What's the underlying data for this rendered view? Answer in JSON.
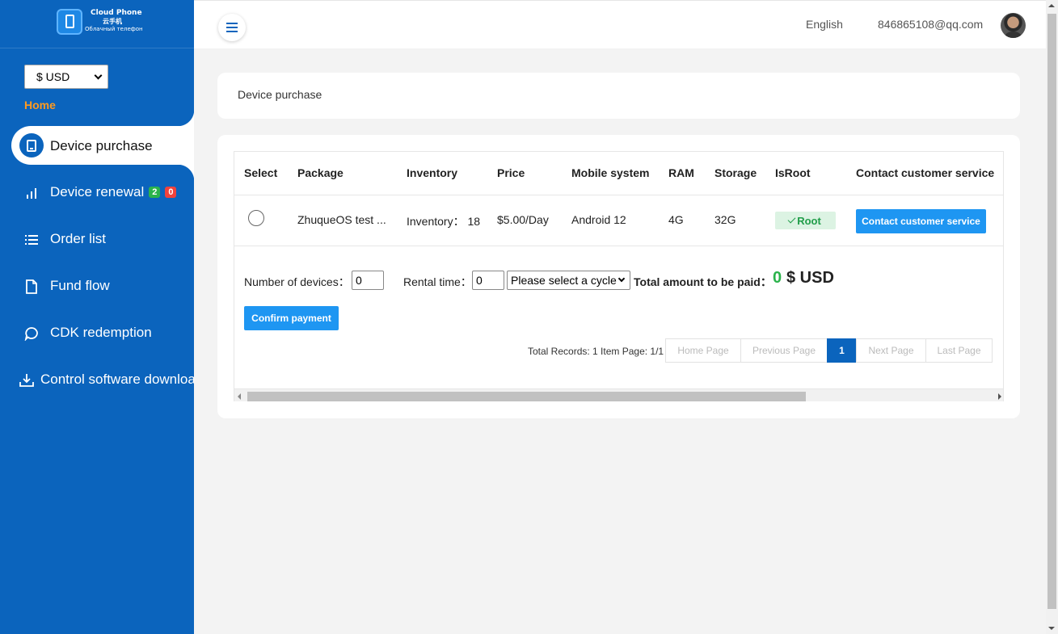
{
  "app": {
    "logo_title": "Cloud Phone",
    "logo_cn": "云手机",
    "logo_sub": "Облачный телефон",
    "currency": "$ USD",
    "home_label": "Home"
  },
  "sidebar": {
    "items": [
      {
        "label": "Device purchase",
        "icon": "tablet-icon",
        "active": true
      },
      {
        "label": "Device renewal",
        "icon": "bar-chart-icon",
        "badges": [
          "2",
          "0"
        ]
      },
      {
        "label": "Order list",
        "icon": "list-icon"
      },
      {
        "label": "Fund flow",
        "icon": "document-icon"
      },
      {
        "label": "CDK redemption",
        "icon": "chat-bubble-icon"
      },
      {
        "label": "Control software download",
        "icon": "download-icon"
      }
    ]
  },
  "header": {
    "language": "English",
    "email": "846865108@qq.com"
  },
  "page": {
    "title": "Device purchase"
  },
  "table": {
    "headers": [
      "Select",
      "Package",
      "Inventory",
      "Price",
      "Mobile system",
      "RAM",
      "Storage",
      "IsRoot",
      "Contact customer service"
    ],
    "rows": [
      {
        "package": "ZhuqueOS test ...",
        "inventory": "Inventory： 18",
        "price": "$5.00/Day",
        "system": "Android 12",
        "ram": "4G",
        "storage": "32G",
        "root": "Root",
        "contact": "Contact customer service"
      }
    ]
  },
  "order": {
    "devices_label": "Number of devices：",
    "devices_value": "0",
    "rental_label": "Rental time：",
    "rental_value": "0",
    "cycle_placeholder": "Please select a cycle",
    "total_label": "Total amount to be paid：",
    "total_value": "0",
    "total_currency": "$ USD",
    "confirm_label": "Confirm payment"
  },
  "pagination": {
    "info": "Total Records: 1 Item Page: 1/1",
    "home": "Home Page",
    "prev": "Previous Page",
    "current": "1",
    "next": "Next Page",
    "last": "Last Page"
  },
  "colors": {
    "sidebar": "#0b64bd",
    "accent_orange": "#ff9a1f",
    "button_blue": "#1e96f2",
    "success_green": "#2bb34b",
    "danger_red": "#f0423c"
  }
}
